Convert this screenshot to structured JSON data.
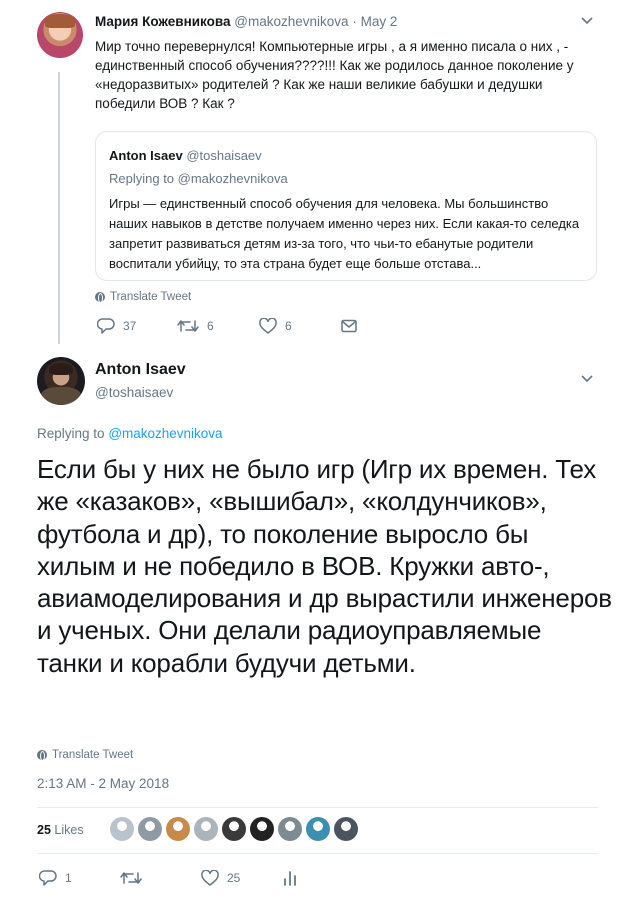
{
  "parent_tweet": {
    "author_name": "Мария Кожевникова",
    "author_handle": "@makozhevnikova",
    "separator": "·",
    "date": "May 2",
    "text": "Мир точно перевернулся! Компьютерные игры , а я именно писала о них , - единственный способ обучения????!!!  Как же родилось данное поколение у «недоразвитых» родителей ? Как же наши великие бабушки и дедушки победили ВОВ ? Как ?",
    "quoted": {
      "author_name": "Anton Isaev",
      "author_handle": "@toshaisaev",
      "replying_to": "Replying to @makozhevnikova",
      "text": "Игры — единственный способ обучения для человека. Мы большинство наших навыков в детстве получаем именно через них. Если какая-то селедка запретит развиваться детям из-за того, что чьи-то ебанутые родители воспитали убийцу, то эта страна будет еще больше отстава..."
    },
    "translate_label": "Translate Tweet",
    "reply_count": "37",
    "retweet_count": "6",
    "like_count": "6"
  },
  "main_tweet": {
    "author_name": "Anton Isaev",
    "author_handle": "@toshaisaev",
    "replying_prefix": "Replying to",
    "replying_handle": "@makozhevnikova",
    "text": "Если бы у них не было игр (Игр их времен. Тех же «казаков», «вышибал», «колдунчиков», футбола и др), то поколение выросло бы хилым и не победило в ВОВ. Кружки авто-, авиамоделирования и др вырастили инженеров и ученых. Они делали радиоуправляемые танки и корабли будучи детьми.",
    "translate_label": "Translate Tweet",
    "timestamp": "2:13 AM - 2 May 2018",
    "likes_count": "25",
    "likes_label": "Likes",
    "reply_count": "1",
    "retweet_count": "",
    "like_count": "25"
  },
  "icons": {
    "reply": "reply-icon",
    "retweet": "retweet-icon",
    "like": "heart-icon",
    "dm": "envelope-icon",
    "analytics": "analytics-icon",
    "more": "chevron-down-icon",
    "translate": "globe-icon"
  },
  "colors": {
    "link": "#1da1f2",
    "secondary_text": "#657786",
    "border": "#e1e8ed"
  },
  "liker_avatars": [
    "#b9c3cb",
    "#8f9aa3",
    "#c78a4a",
    "#aab4bc",
    "#3a3a3a",
    "#222222",
    "#7c8a94",
    "#3c8fb0",
    "#4b5560"
  ]
}
